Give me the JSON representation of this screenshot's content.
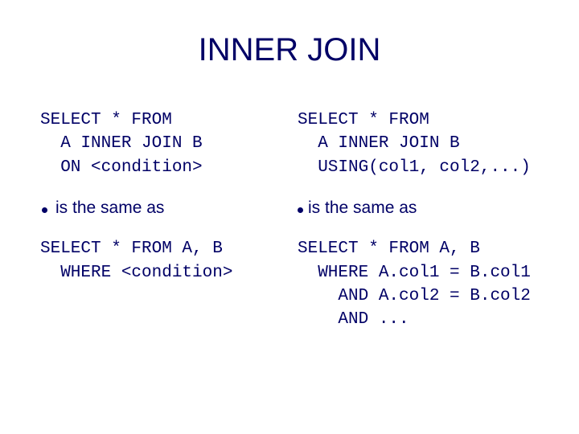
{
  "title": "INNER JOIN",
  "left": {
    "code1": "SELECT * FROM\n  A INNER JOIN B\n  ON <condition>",
    "bullet": "is the same as",
    "code2": "SELECT * FROM A, B\n  WHERE <condition>"
  },
  "right": {
    "code1": "SELECT * FROM\n  A INNER JOIN B\n  USING(col1, col2,...)",
    "bullet": "is the same as",
    "code2": "SELECT * FROM A, B\n  WHERE A.col1 = B.col1\n    AND A.col2 = B.col2\n    AND ..."
  }
}
